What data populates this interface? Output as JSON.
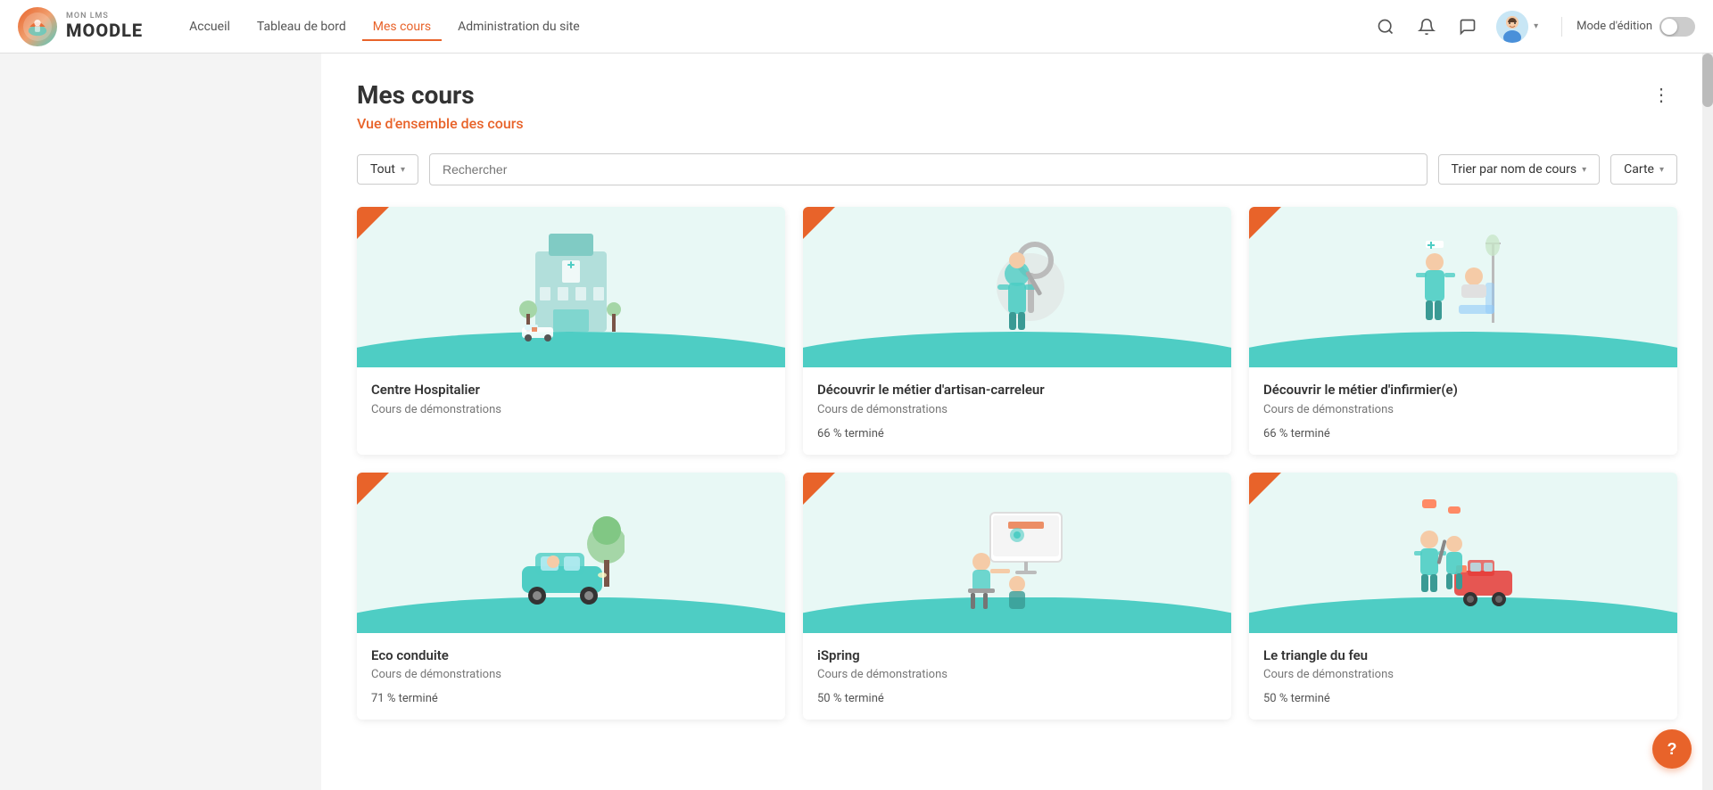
{
  "brand": {
    "sub": "MON LMS",
    "main": "MOODLE"
  },
  "nav": {
    "links": [
      {
        "id": "accueil",
        "label": "Accueil",
        "active": false
      },
      {
        "id": "tableau-de-bord",
        "label": "Tableau de bord",
        "active": false
      },
      {
        "id": "mes-cours",
        "label": "Mes cours",
        "active": true
      },
      {
        "id": "administration",
        "label": "Administration du site",
        "active": false
      }
    ]
  },
  "toolbar": {
    "mode_label": "Mode d'édition"
  },
  "page": {
    "title": "Mes cours",
    "subtitle": "Vue d'ensemble des cours",
    "more_btn": "⋮"
  },
  "filters": {
    "all_label": "Tout",
    "search_placeholder": "Rechercher",
    "sort_label": "Trier par nom de cours",
    "view_label": "Carte"
  },
  "courses": [
    {
      "id": "course-1",
      "name": "Centre Hospitalier",
      "category": "Cours de démonstrations",
      "progress": null,
      "progress_label": "",
      "theme": "hospital"
    },
    {
      "id": "course-2",
      "name": "Découvrir le métier d'artisan-carreleur",
      "category": "Cours de démonstrations",
      "progress": 66,
      "progress_label": "66 % terminé",
      "theme": "mechanic"
    },
    {
      "id": "course-3",
      "name": "Découvrir le métier d'infirmier(e)",
      "category": "Cours de démonstrations",
      "progress": 66,
      "progress_label": "66 % terminé",
      "theme": "nurse"
    },
    {
      "id": "course-4",
      "name": "Eco conduite",
      "category": "Cours de démonstrations",
      "progress": 71,
      "progress_label": "71 % terminé",
      "theme": "car"
    },
    {
      "id": "course-5",
      "name": "iSpring",
      "category": "Cours de démonstrations",
      "progress": 50,
      "progress_label": "50 % terminé",
      "theme": "ispring"
    },
    {
      "id": "course-6",
      "name": "Le triangle du feu",
      "category": "Cours de démonstrations",
      "progress": 50,
      "progress_label": "50 % terminé",
      "theme": "fire"
    }
  ]
}
